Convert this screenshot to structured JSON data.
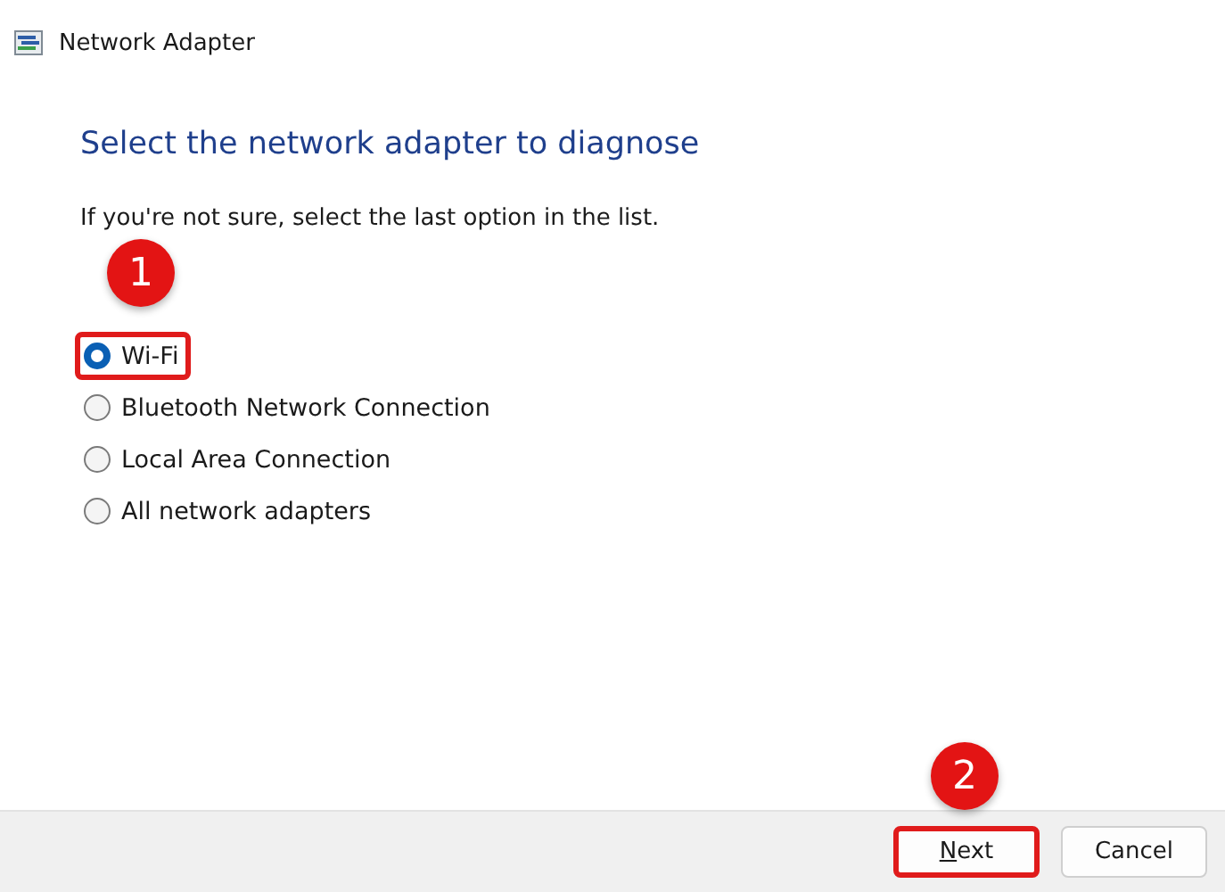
{
  "window": {
    "title": "Network Adapter"
  },
  "heading": "Select the network adapter to diagnose",
  "instruction": "If you're not sure, select the last option in the list.",
  "options": [
    {
      "label": "Wi-Fi",
      "selected": true,
      "highlighted": true,
      "callout": "1"
    },
    {
      "label": "Bluetooth Network Connection",
      "selected": false,
      "highlighted": false
    },
    {
      "label": "Local Area Connection",
      "selected": false,
      "highlighted": false
    },
    {
      "label": "All network adapters",
      "selected": false,
      "highlighted": false
    }
  ],
  "buttons": [
    {
      "label": "Next",
      "kind": "primary",
      "highlighted": true,
      "callout": "2"
    },
    {
      "label": "Cancel",
      "kind": "secondary",
      "highlighted": false
    }
  ]
}
